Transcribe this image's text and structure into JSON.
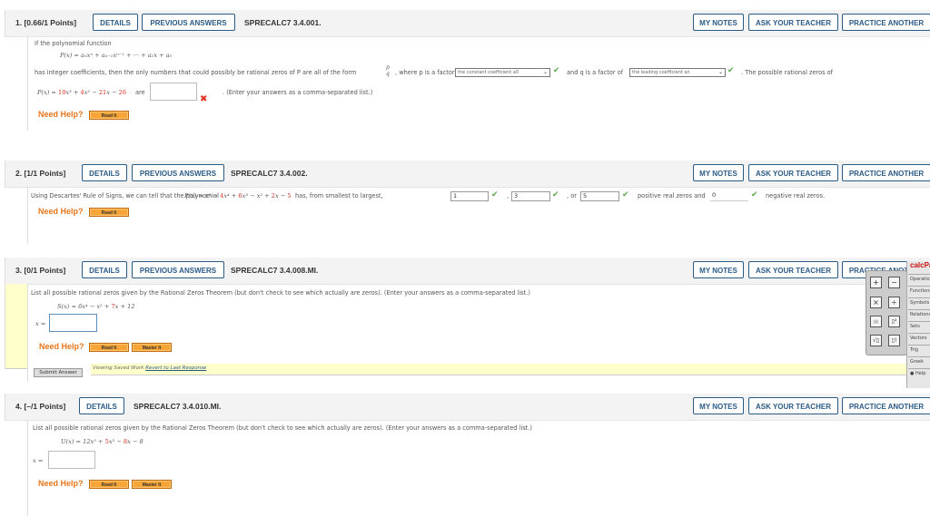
{
  "common": {
    "details": "DETAILS",
    "previous_answers": "PREVIOUS ANSWERS",
    "my_notes": "MY NOTES",
    "ask_teacher": "ASK YOUR TEACHER",
    "practice_another": "PRACTICE ANOTHER",
    "need_help": "Need Help?",
    "read_it": "Read It",
    "master_it": "Master It",
    "x_eq": "x ="
  },
  "q1": {
    "number": "1.",
    "points": "[0.66/1 Points]",
    "code": "SPRECALC7 3.4.001.",
    "line1": "If the polynomial function",
    "formula": "P(x) = aₙxⁿ + aₙ₋₁xⁿ⁻¹ + ··· + a₁x + a₀",
    "line2a": "has integer coefficients, then the only numbers that could possibly be rational zeros of P are all of the form",
    "frac_num": "p",
    "frac_den": "q",
    "line2b": ", where p is a factor of",
    "select1": "the constant coefficient a0",
    "line2c": "and q is a factor of",
    "select2": "the leading coefficient an",
    "line2d": ". The possible rational zeros of",
    "poly": {
      "pre": "P(x) = ",
      "c1": "10",
      "t1": "x³ + ",
      "c2": "4",
      "t2": "x² − ",
      "c3": "21",
      "t3": "x − ",
      "c4": "26"
    },
    "are": "are",
    "answer": "",
    "hint": ". (Enter your answers as a comma-separated list.)",
    "status": "incorrect"
  },
  "q2": {
    "number": "2.",
    "points": "[1/1 Points]",
    "code": "SPRECALC7 3.4.002.",
    "text": "Using Descartes' Rule of Signs, we can tell that the polynomial",
    "poly": {
      "pre": "P(x) = x⁵ − ",
      "c1": "4",
      "t1": "x⁴ + ",
      "c2": "6",
      "t2": "x³ − x² + ",
      "c3": "2",
      "t3": "x − ",
      "c4": "5"
    },
    "text2": "has, from smallest to largest,",
    "answers": [
      "1",
      "3",
      "5",
      "0"
    ],
    "sep1": ",",
    "sep2": ", or",
    "positive": "positive real zeros and",
    "negative": "negative real zeros."
  },
  "q3": {
    "number": "3.",
    "points": "[0/1 Points]",
    "code": "SPRECALC7 3.4.008.MI.",
    "text": "List all possible rational zeros given by the Rational Zeros Theorem (but don't check to see which actually are zeros). (Enter your answers as a comma-separated list.)",
    "poly": {
      "pre": "S(x) = 6x⁴ − x² + ",
      "c1": "7",
      "t1": "x + 12"
    },
    "answer": "",
    "submit": "Submit Answer",
    "saved_text": "Viewing Saved Work",
    "revert": "Revert to Last Response"
  },
  "q4": {
    "number": "4.",
    "points": "[–/1 Points]",
    "code": "SPRECALC7 3.4.010.MI.",
    "text": "List all possible rational zeros given by the Rational Zeros Theorem (but don't check to see which actually are zeros). (Enter your answers as a comma-separated list.)",
    "poly": {
      "pre": "U(x) = 12x⁵ + ",
      "c1": "5",
      "t1": "x³ − ",
      "c2": "8",
      "t2": "x − 8"
    },
    "answer": ""
  },
  "calcpad": {
    "title": "calcPad",
    "keys": [
      "+",
      "−",
      "×",
      "÷",
      "▯/▯",
      "▯²",
      "√▯",
      "▯!"
    ],
    "menu": [
      "Operations",
      "Functions",
      "Symbols",
      "Relations",
      "Sets",
      "Vectors",
      "Trig",
      "Greek",
      "Help"
    ]
  }
}
